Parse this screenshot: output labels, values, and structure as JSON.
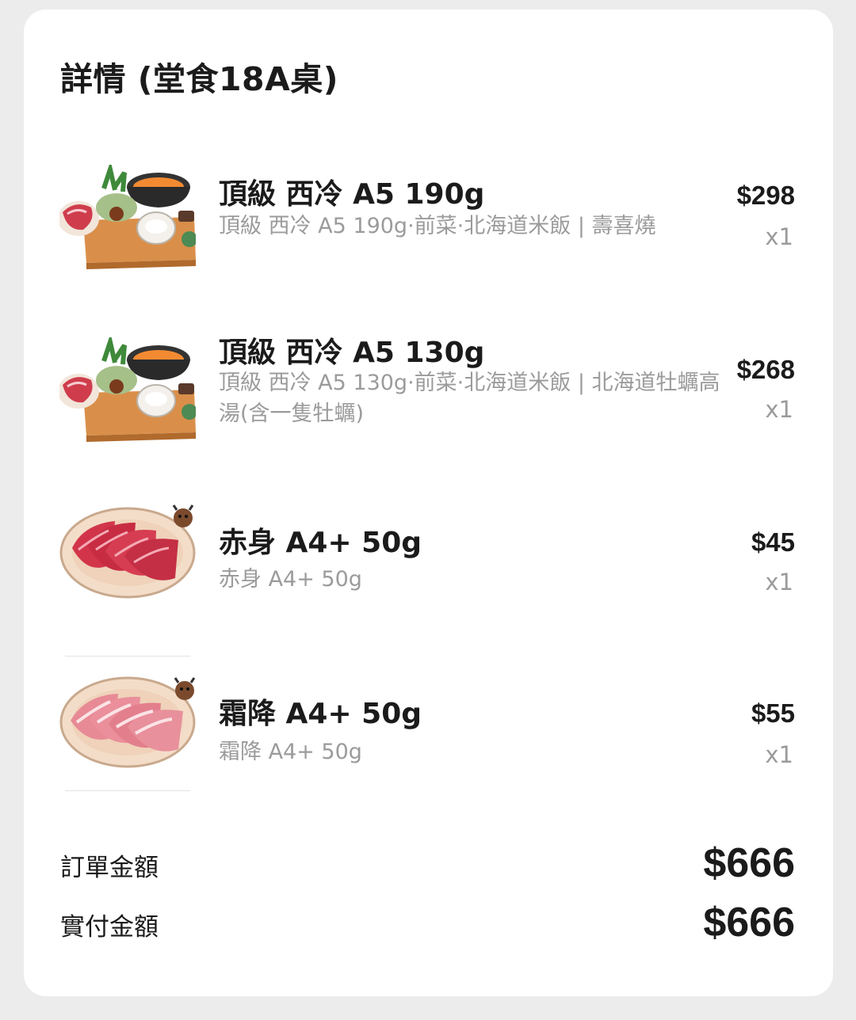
{
  "header": {
    "title": "詳情 (堂食18A桌)"
  },
  "items": [
    {
      "name": "頂級 西冷 A5 190g",
      "desc": "頂級 西冷 A5 190g·前菜·北海道米飯 | 壽喜燒",
      "price": "$298",
      "qty": "x1",
      "image": "hotpot-set-image"
    },
    {
      "name": "頂級 西冷 A5 130g",
      "desc": "頂級 西冷 A5 130g·前菜·北海道米飯 | 北海道牡蠣高湯(含一隻牡蠣)",
      "price": "$268",
      "qty": "x1",
      "image": "hotpot-set-image"
    },
    {
      "name": "赤身 A4+ 50g",
      "desc": "赤身 A4+ 50g",
      "price": "$45",
      "qty": "x1",
      "image": "beef-plate-image"
    },
    {
      "name": "霜降 A4+ 50g",
      "desc": "霜降 A4+ 50g",
      "price": "$55",
      "qty": "x1",
      "image": "marbled-beef-plate-image"
    }
  ],
  "summary": {
    "order_label": "訂單金額",
    "order_value": "$666",
    "paid_label": "實付金額",
    "paid_value": "$666"
  },
  "colors": {
    "background": "#ececec",
    "card": "#ffffff",
    "text": "#1b1b1b",
    "muted": "#9b9b9b"
  }
}
